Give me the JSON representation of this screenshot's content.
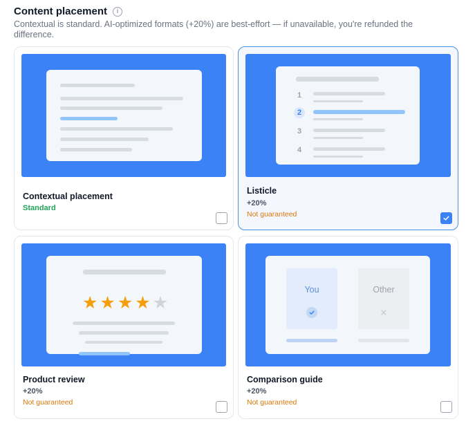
{
  "header": {
    "title": "Content placement",
    "info_glyph": "i",
    "subtitle": "Contextual is standard. AI-optimized formats (+20%) are best-effort — if unavailable, you're refunded the difference."
  },
  "cards": [
    {
      "name": "Contextual placement",
      "price": "",
      "status": "Standard",
      "checked": false
    },
    {
      "name": "Listicle",
      "price": "+20%",
      "status": "Not guaranteed",
      "checked": true
    },
    {
      "name": "Product review",
      "price": "+20%",
      "status": "Not guaranteed",
      "checked": false
    },
    {
      "name": "Comparison guide",
      "price": "+20%",
      "status": "Not guaranteed",
      "checked": false
    }
  ],
  "listicle_numbers": [
    "1",
    "2",
    "3",
    "4"
  ],
  "rating": {
    "value": 4,
    "max": 5
  },
  "comparison": {
    "you_label": "You",
    "other_label": "Other"
  },
  "colors": {
    "accent": "#3b82f6",
    "standard": "#22a35a",
    "warning": "#d97706"
  }
}
